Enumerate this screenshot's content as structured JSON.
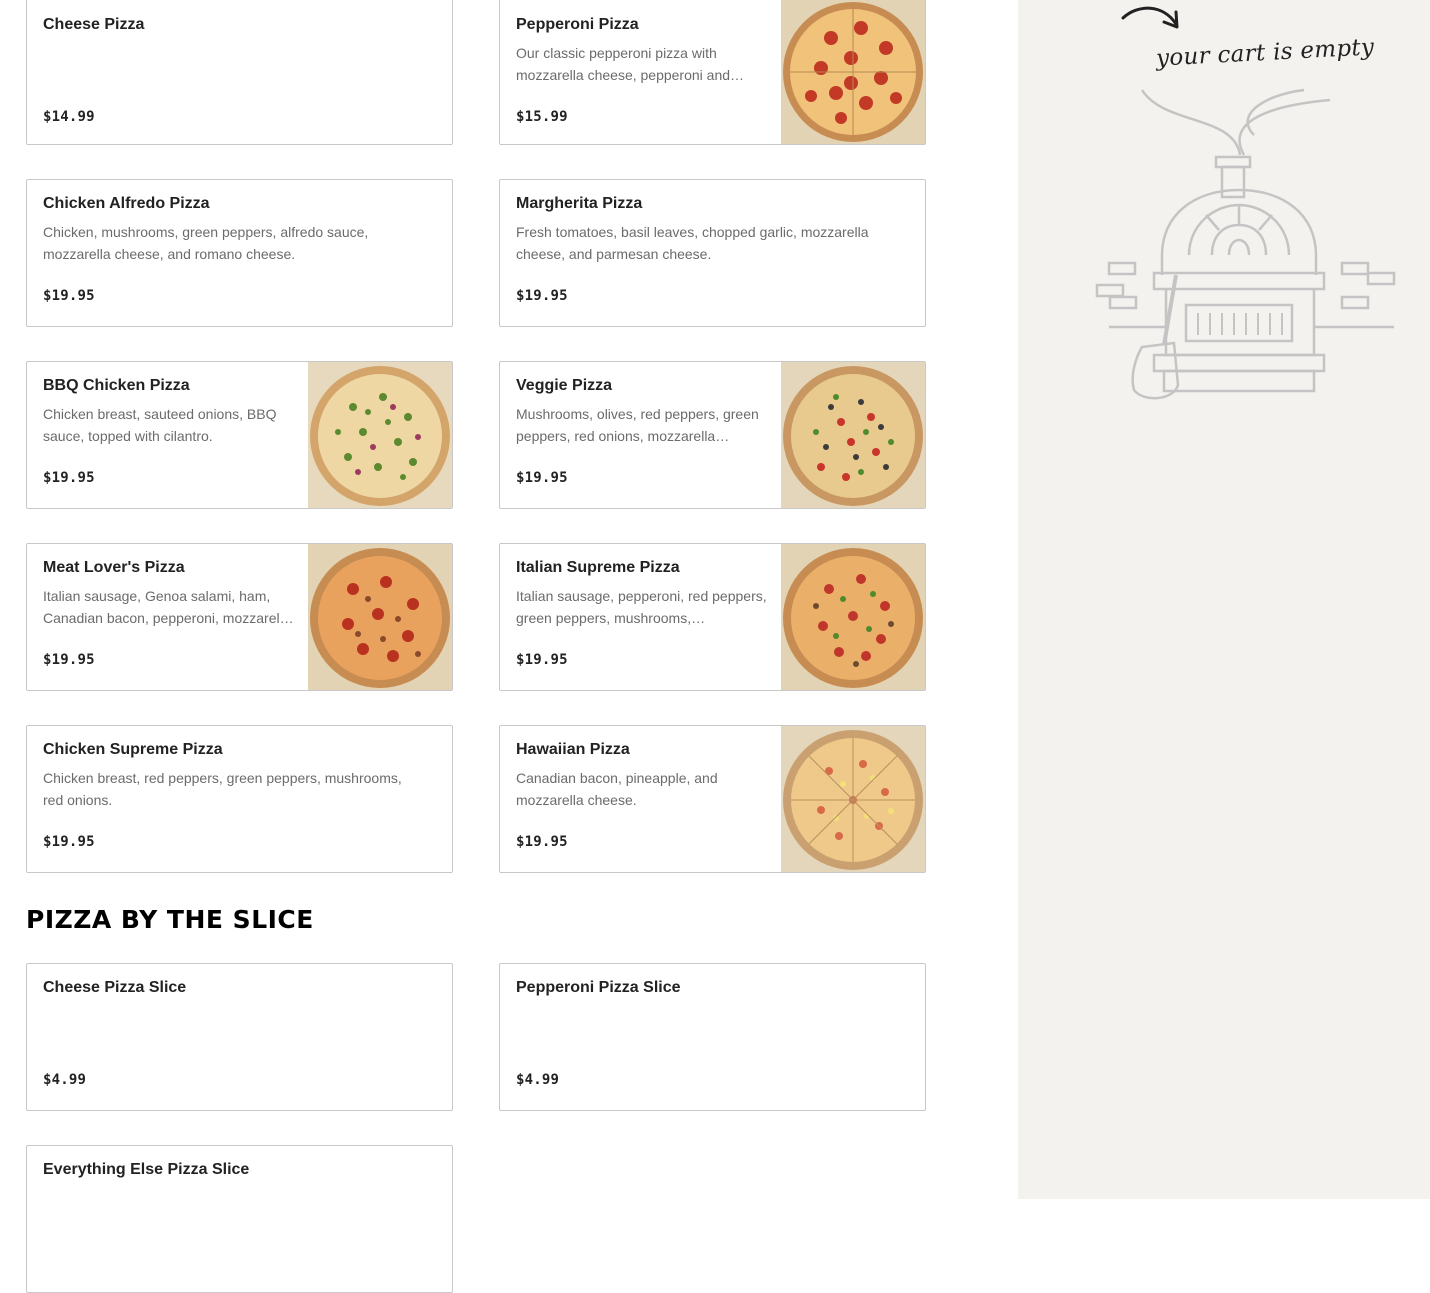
{
  "menu": {
    "pizzas": [
      {
        "name": "Cheese Pizza",
        "description": "",
        "price": "$14.99",
        "image": ""
      },
      {
        "name": "Pepperoni Pizza",
        "description": "Our classic pepperoni pizza with mozzarella cheese, pepperoni and…",
        "price": "$15.99",
        "image": "pepperoni"
      },
      {
        "name": "Chicken Alfredo Pizza",
        "description": "Chicken, mushrooms, green peppers, alfredo sauce, mozzarella cheese, and romano cheese.",
        "price": "$19.95",
        "image": ""
      },
      {
        "name": "Margherita Pizza",
        "description": "Fresh tomatoes, basil leaves, chopped garlic, mozzarella cheese, and parmesan cheese.",
        "price": "$19.95",
        "image": ""
      },
      {
        "name": "BBQ Chicken Pizza",
        "description": "Chicken breast, sauteed onions, BBQ sauce, topped with cilantro.",
        "price": "$19.95",
        "image": "bbq"
      },
      {
        "name": "Veggie Pizza",
        "description": "Mushrooms, olives, red peppers, green peppers, red onions, mozzarella…",
        "price": "$19.95",
        "image": "veggie"
      },
      {
        "name": "Meat Lover's Pizza",
        "description": "Italian sausage, Genoa salami, ham, Canadian bacon, pepperoni, mozzarel…",
        "price": "$19.95",
        "image": "meat"
      },
      {
        "name": "Italian Supreme Pizza",
        "description": "Italian sausage, pepperoni, red peppers, green peppers, mushrooms,…",
        "price": "$19.95",
        "image": "supreme"
      },
      {
        "name": "Chicken Supreme Pizza",
        "description": "Chicken breast, red peppers, green peppers, mushrooms, red onions.",
        "price": "$19.95",
        "image": ""
      },
      {
        "name": "Hawaiian Pizza",
        "description": "Canadian bacon, pineapple, and mozzarella cheese.",
        "price": "$19.95",
        "image": "hawaiian"
      }
    ],
    "slice_section": {
      "title": "PIZZA BY THE SLICE",
      "items": [
        {
          "name": "Cheese Pizza Slice",
          "description": "",
          "price": "$4.99",
          "image": ""
        },
        {
          "name": "Pepperoni Pizza Slice",
          "description": "",
          "price": "$4.99",
          "image": ""
        },
        {
          "name": "Everything Else Pizza Slice",
          "description": "",
          "price": "",
          "image": ""
        }
      ]
    }
  },
  "cart": {
    "empty_text": "your cart is empty",
    "illustration": "pizza-oven-illustration",
    "arrow_icon": "curved-arrow-icon"
  },
  "colors": {
    "cart_bg": "#f3f2ef",
    "card_border": "#c8c8c8",
    "oven_line": "#c4c4c4"
  }
}
